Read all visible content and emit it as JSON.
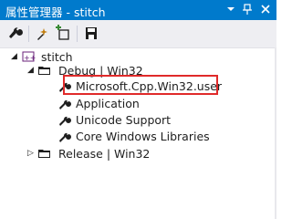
{
  "window": {
    "title": "属性管理器 - stitch",
    "dropdown_icon": "chevron-down-icon",
    "pin_icon": "pin-icon",
    "close_icon": "close-icon"
  },
  "toolbar": {
    "buttons": [
      {
        "name": "properties-button",
        "icon": "wrench-icon"
      },
      {
        "name": "add-new-property-sheet-button",
        "icon": "new-sheet-icon"
      },
      {
        "name": "add-existing-property-sheet-button",
        "icon": "add-sheet-icon"
      },
      {
        "name": "save-button",
        "icon": "save-icon"
      }
    ]
  },
  "tree": {
    "project": {
      "label": "stitch"
    },
    "configurations": [
      {
        "label": "Debug | Win32",
        "expanded": true,
        "sheets": [
          {
            "label": "Microsoft.Cpp.Win32.user",
            "highlighted": true
          },
          {
            "label": "Application"
          },
          {
            "label": "Unicode Support"
          },
          {
            "label": "Core Windows Libraries"
          }
        ]
      },
      {
        "label": "Release | Win32",
        "expanded": false
      }
    ]
  },
  "colors": {
    "titlebar": "#007acc",
    "highlight_border": "#e02a2a",
    "toolbar_bg": "#eeeef2"
  }
}
